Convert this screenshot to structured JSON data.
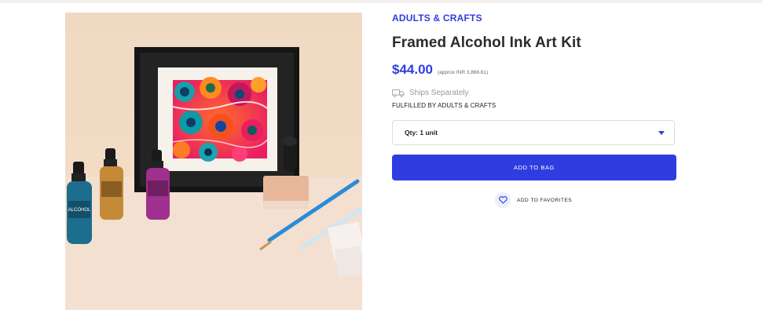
{
  "product": {
    "brand": "ADULTS & CRAFTS",
    "title": "Framed Alcohol Ink Art Kit",
    "price": "$44.00",
    "price_approx": "(approx INR 3,866.61)",
    "ships": "Ships Separately",
    "fulfilled_by": "FULFILLED BY ADULTS & CRAFTS",
    "image_alt_icon": "zoom-icon"
  },
  "quantity": {
    "selected": "Qty: 1 unit"
  },
  "actions": {
    "add_to_bag": "ADD TO BAG",
    "add_to_favorites": "ADD TO FAVORITES"
  },
  "image_text": {
    "bottle_label": "ALCOHOL"
  },
  "colors": {
    "accent": "#2f3de0",
    "text": "#2b2b2b",
    "muted": "#9a9a9a",
    "border": "#dcdcdc",
    "favorite_bg": "#eceefc"
  },
  "icons": {
    "ships": "truck-icon",
    "favorite": "heart-icon",
    "dropdown": "chevron-down-icon",
    "zoom": "zoom-icon"
  }
}
